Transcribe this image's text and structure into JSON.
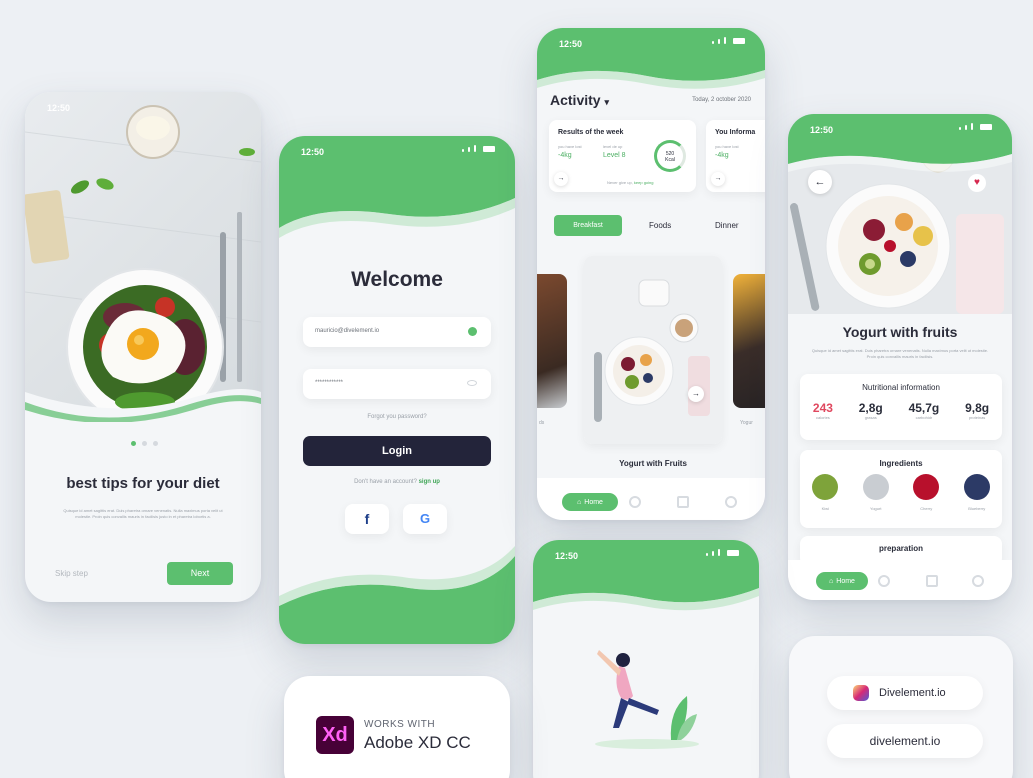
{
  "colors": {
    "accent": "#5cbf6f",
    "accent_dark": "#3fa556",
    "dark_button": "#23243a",
    "background": "#edf0f4"
  },
  "onboarding": {
    "status_time": "12:50",
    "title": "best tips for your diet",
    "body": "Quisque id amet sagittis erat. Duis pharetra ornare venenatis. Nulla maximus porta velit ut molestie. Proin quis convallis mauris in facilisis justo in et pharetra lobortis a.",
    "skip_label": "Skip step",
    "next_label": "Next",
    "page_dots": 3,
    "active_dot": 0
  },
  "login": {
    "status_time": "12:50",
    "title": "Welcome",
    "email_value": "mauricio@divelement.io",
    "password_value": "************",
    "forgot_label": "Forgot you password?",
    "login_label": "Login",
    "signup_prompt": "Don't have an account?",
    "signup_link": "sign up",
    "facebook_label": "f",
    "google_label": "G"
  },
  "activity": {
    "status_time": "12:50",
    "title": "Activity",
    "date": "Today, 2 october 2020",
    "results_card": {
      "title": "Results of the week",
      "lost_caption": "you have lost",
      "lost_value": "-4kg",
      "level_caption": "level de up",
      "level_value": "Level 8",
      "kcal_value": "520",
      "kcal_unit": "Kcal",
      "footnote": "Never give up, ",
      "footnote_link": "keep going"
    },
    "info_card": {
      "title": "You Informa",
      "lost_value": "-4kg",
      "caption": "you have lost"
    },
    "tabs": [
      "Breakfast",
      "Foods",
      "Dinner"
    ],
    "active_tab": "Breakfast",
    "featured_title": "Yogurt with Fruits",
    "side_label_left": "ds",
    "side_label_right": "Yogur",
    "nav_home": "Home"
  },
  "detail": {
    "status_time": "12:50",
    "title": "Yogurt with fruits",
    "description": "Quisque id amet sagittis erat. Duis pharetra ornare venenatis. Nulla maximus porta velit ut molestie. Proin quis convallis mauris in facilisis.",
    "nutrition_title": "Nutritional information",
    "nutrition": [
      {
        "value": "243",
        "label": "calories",
        "highlight": true
      },
      {
        "value": "2,8g",
        "label": "grasas",
        "highlight": false
      },
      {
        "value": "45,7g",
        "label": "carbohidr",
        "highlight": false
      },
      {
        "value": "9,8g",
        "label": "proteinas",
        "highlight": false
      }
    ],
    "ingredients_title": "Ingredients",
    "ingredients": [
      {
        "name": "Kiwi",
        "color": "#7ea33a"
      },
      {
        "name": "Yogurt",
        "color": "#c9cdd2"
      },
      {
        "name": "Cherry",
        "color": "#b8102c"
      },
      {
        "name": "Blueberry",
        "color": "#2c3a66"
      }
    ],
    "preparation_title": "preparation",
    "nav_home": "Home"
  },
  "splash": {
    "status_time": "12:50"
  },
  "xd_badge": {
    "logo": "Xd",
    "line1": "WORKS WITH",
    "line2": "Adobe XD CC"
  },
  "links": {
    "instagram": "Divelement.io",
    "website": "divelement.io"
  }
}
